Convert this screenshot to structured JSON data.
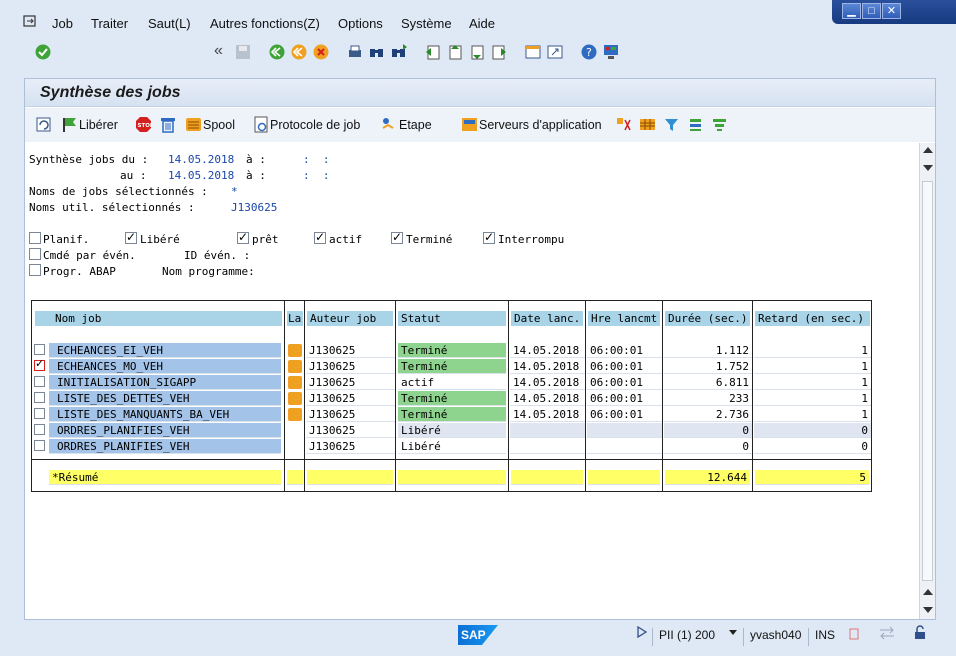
{
  "menu": {
    "items": [
      "Job",
      "Traiter",
      "Saut(L)",
      "Autres fonctions(Z)",
      "Options",
      "Système",
      "Aide"
    ]
  },
  "toolbar": {
    "command_value": "",
    "back_glyph": "«",
    "icons": [
      "enter-icon",
      "save-icon",
      "back-icon",
      "exit-icon",
      "cancel-icon",
      "print-icon",
      "find-icon",
      "find-next-icon",
      "first-page-icon",
      "prev-page-icon",
      "next-page-icon",
      "last-page-icon",
      "new-session-icon",
      "shortcut-icon",
      "help-icon",
      "layout-icon"
    ]
  },
  "page": {
    "title": "Synthèse des jobs"
  },
  "app_toolbar": {
    "refresh": "",
    "liberer": "Libérer",
    "spool": "Spool",
    "protocole": "Protocole de job",
    "etape": "Etape",
    "serveurs": "Serveurs d'application"
  },
  "selection": {
    "line1_label": "Synthèse jobs du :",
    "from_date": "14.05.2018",
    "a1": "à :",
    "from_time": ":  :",
    "line2_label": "au :",
    "to_date": "14.05.2018",
    "a2": "à :",
    "to_time": ":  :",
    "jobs_label": "Noms de jobs sélectionnés :",
    "jobs_value": "*",
    "users_label": "Noms util. sélectionnés :",
    "users_value": "J130625"
  },
  "filters": {
    "planif": {
      "label": "Planif.",
      "checked": false
    },
    "libere": {
      "label": "Libéré",
      "checked": true
    },
    "pret": {
      "label": "prêt",
      "checked": true
    },
    "actif": {
      "label": "actif",
      "checked": true
    },
    "termine": {
      "label": "Terminé",
      "checked": true
    },
    "interrompu": {
      "label": "Interrompu",
      "checked": true
    },
    "cmde": {
      "label": "Cmdé par évén.",
      "checked": false
    },
    "id_even": "ID évén. :",
    "progr": {
      "label": "Progr. ABAP",
      "checked": false
    },
    "nom_programme": "Nom programme:"
  },
  "table": {
    "headers": [
      "Nom job",
      "La",
      "Auteur job",
      "Statut",
      "Date lanc.",
      "Hre lancmt",
      "Durée (sec.)",
      "Retard (en sec.)"
    ],
    "rows": [
      {
        "name": "ECHEANCES_EI_VEH",
        "author": "J130625",
        "status": "Terminé",
        "date": "14.05.2018",
        "time": "06:00:01",
        "duration": "1.112",
        "delay": "1",
        "checked": false,
        "lamp": true
      },
      {
        "name": "ECHEANCES_MO_VEH",
        "author": "J130625",
        "status": "Terminé",
        "date": "14.05.2018",
        "time": "06:00:01",
        "duration": "1.752",
        "delay": "1",
        "checked": true,
        "lamp": true
      },
      {
        "name": "INITIALISATION_SIGAPP",
        "author": "J130625",
        "status": "actif",
        "date": "14.05.2018",
        "time": "06:00:01",
        "duration": "6.811",
        "delay": "1",
        "checked": false,
        "lamp": true
      },
      {
        "name": "LISTE_DES_DETTES_VEH",
        "author": "J130625",
        "status": "Terminé",
        "date": "14.05.2018",
        "time": "06:00:01",
        "duration": "233",
        "delay": "1",
        "checked": false,
        "lamp": true
      },
      {
        "name": "LISTE_DES_MANQUANTS_BA_VEH",
        "author": "J130625",
        "status": "Terminé",
        "date": "14.05.2018",
        "time": "06:00:01",
        "duration": "2.736",
        "delay": "1",
        "checked": false,
        "lamp": true
      },
      {
        "name": "ORDRES_PLANIFIES_VEH",
        "author": "J130625",
        "status": "Libéré",
        "date": "",
        "time": "",
        "duration": "0",
        "delay": "0",
        "checked": false,
        "lamp": false
      },
      {
        "name": "ORDRES_PLANIFIES_VEH",
        "author": "J130625",
        "status": "Libéré",
        "date": "",
        "time": "",
        "duration": "0",
        "delay": "0",
        "checked": false,
        "lamp": false
      }
    ],
    "summary": {
      "label": "*Résumé",
      "duration": "12.644",
      "delay": "5"
    }
  },
  "status": {
    "system": "PII (1) 200",
    "server": "yvash040",
    "mode": "INS",
    "logo": "SAP"
  }
}
